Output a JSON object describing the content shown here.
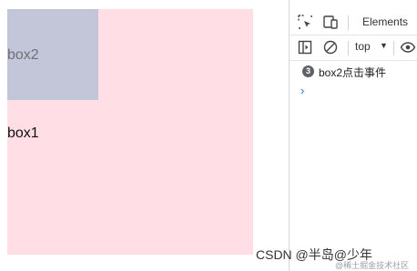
{
  "page": {
    "box1_label": "box1",
    "box2_label": "box2"
  },
  "devtools": {
    "toolbar": {
      "inspect_icon": "inspect-element-icon",
      "device_icon": "device-toolbar-icon",
      "elements_tab": "Elements"
    },
    "console_bar": {
      "sidebar_icon": "show-sidebar-icon",
      "clear_icon": "clear-console-icon",
      "context": "top",
      "eye_icon": "live-expression-eye-icon"
    },
    "messages": [
      {
        "count": "3",
        "text": "box2点击事件"
      }
    ],
    "prompt": "›"
  },
  "watermark": {
    "text": "CSDN @半岛@少年",
    "sub": "@稀土掘金技术社区"
  },
  "colors": {
    "box1": "#ffdfe5",
    "box2": "#c3c6d8",
    "accent": "#1a73e8"
  }
}
